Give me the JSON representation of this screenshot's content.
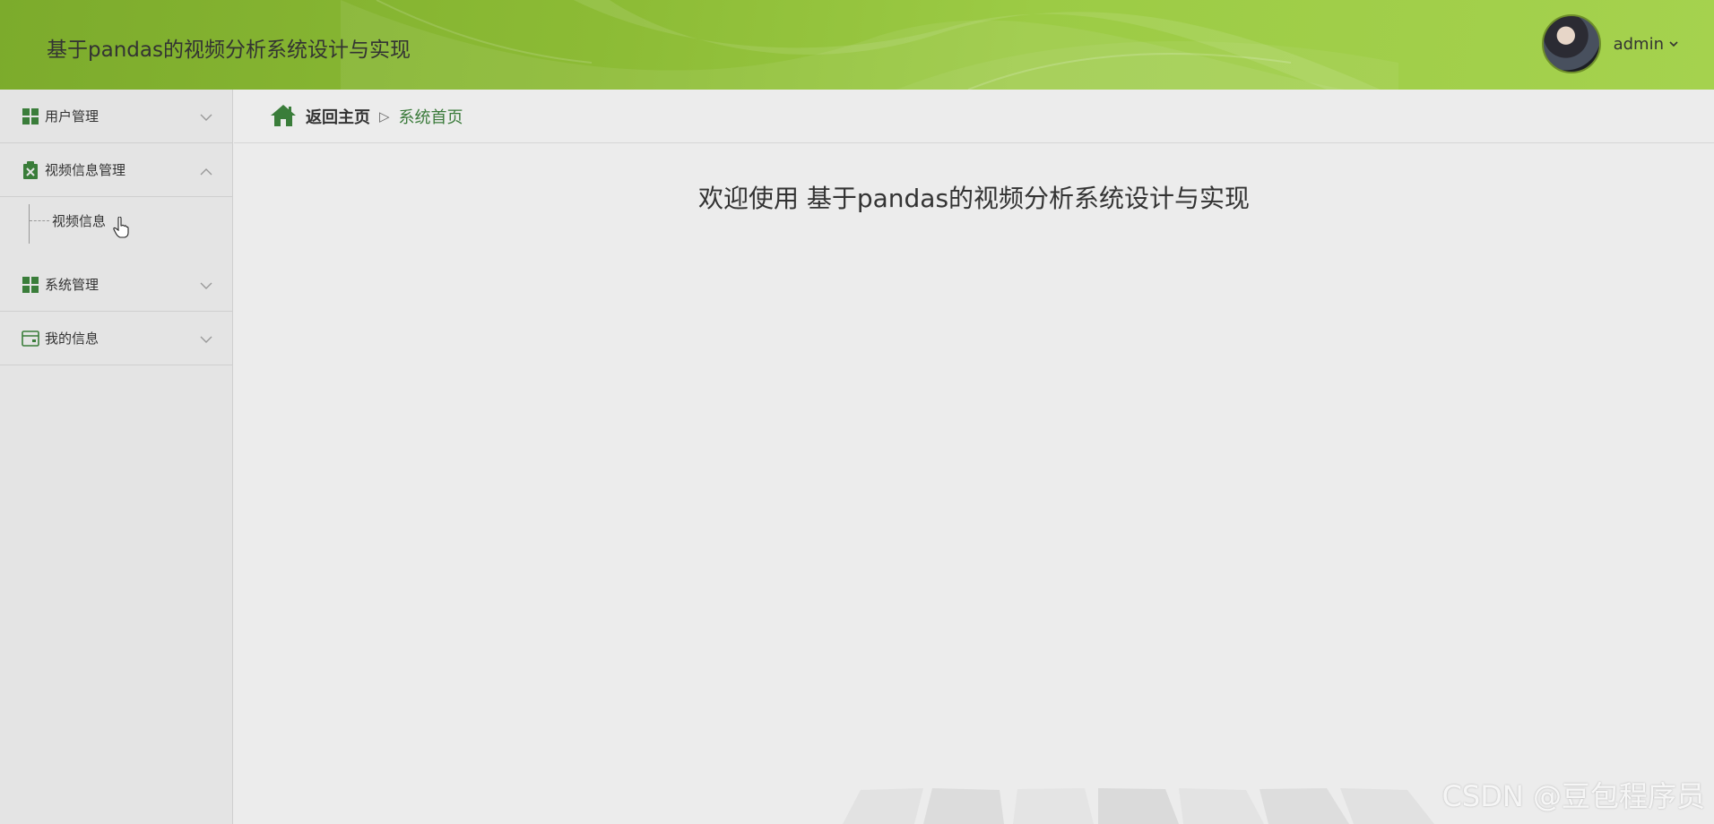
{
  "header": {
    "title": "基于pandas的视频分析系统设计与实现",
    "username": "admin",
    "caret_icon": "chevron-down-icon"
  },
  "sidebar": {
    "items": [
      {
        "label": "用户管理",
        "icon": "grid-icon",
        "expanded": false
      },
      {
        "label": "视频信息管理",
        "icon": "clipboard-icon",
        "expanded": true,
        "children": [
          "视频信息"
        ]
      },
      {
        "label": "系统管理",
        "icon": "grid-icon",
        "expanded": false
      },
      {
        "label": "我的信息",
        "icon": "card-icon",
        "expanded": false
      }
    ]
  },
  "breadcrumb": {
    "home_label": "返回主页",
    "separator": "▷",
    "current_label": "系统首页"
  },
  "main": {
    "welcome_text": "欢迎使用 基于pandas的视频分析系统设计与实现"
  },
  "watermark": "CSDN @豆包程序员",
  "colors": {
    "header_green": "#8cbb35",
    "icon_green": "#3a7d3a",
    "background": "#ececec"
  }
}
